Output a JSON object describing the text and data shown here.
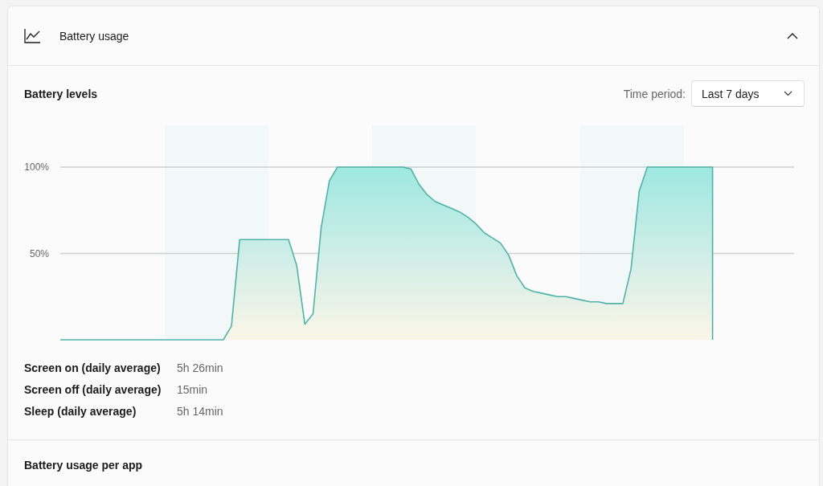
{
  "section": {
    "title": "Battery usage",
    "expanded": true
  },
  "battery_levels": {
    "title": "Battery levels",
    "time_period_label": "Time period:",
    "time_period_value": "Last 7 days",
    "chart_data": {
      "type": "area",
      "ylim": [
        0,
        100
      ],
      "yticks": [
        {
          "value": 50,
          "label": "50%"
        },
        {
          "value": 100,
          "label": "100%"
        }
      ],
      "categories": [
        null,
        null,
        null,
        null,
        null,
        null,
        null,
        null,
        null,
        null,
        null,
        null,
        null,
        null,
        null,
        null,
        null,
        null,
        null,
        null,
        null,
        null,
        null,
        null,
        null,
        null,
        null,
        null,
        null,
        null,
        null,
        null,
        null,
        null,
        null,
        null,
        null,
        null,
        null,
        null,
        null,
        null,
        null,
        null,
        null,
        null,
        null,
        null,
        null,
        null,
        null,
        null,
        null,
        null,
        null,
        null,
        null,
        null,
        null,
        null,
        null,
        null,
        null,
        null,
        null,
        null,
        null,
        null,
        null,
        null,
        null,
        null,
        null,
        null,
        null,
        null,
        null,
        null,
        null,
        null,
        null,
        null,
        null,
        null,
        null,
        null,
        null,
        null,
        null,
        null,
        null
      ],
      "series": [
        {
          "color": "#4fb3a9",
          "values": [
            0,
            0,
            0,
            0,
            0,
            0,
            0,
            0,
            0,
            0,
            0,
            0,
            0,
            0,
            0,
            0,
            0,
            0,
            0,
            0,
            0,
            8,
            58,
            58,
            58,
            58,
            58,
            58,
            58,
            43,
            9,
            15,
            65,
            92,
            100,
            100,
            100,
            100,
            100,
            100,
            100,
            100,
            100,
            99,
            90,
            84,
            80,
            78,
            76,
            74,
            71,
            67,
            62,
            59,
            56,
            49,
            37,
            30,
            28,
            27,
            26,
            25,
            25,
            24,
            23,
            22,
            22,
            21,
            21,
            21,
            41,
            86,
            100,
            100,
            100,
            100,
            100,
            100,
            100,
            100,
            100,
            null,
            null,
            null,
            null,
            null,
            null,
            null,
            null,
            null,
            null
          ]
        }
      ]
    }
  },
  "stats": [
    {
      "label": "Screen on (daily average)",
      "value": "5h 26min"
    },
    {
      "label": "Screen off (daily average)",
      "value": "15min"
    },
    {
      "label": "Sleep (daily average)",
      "value": "5h 14min"
    }
  ],
  "per_app": {
    "title": "Battery usage per app"
  }
}
